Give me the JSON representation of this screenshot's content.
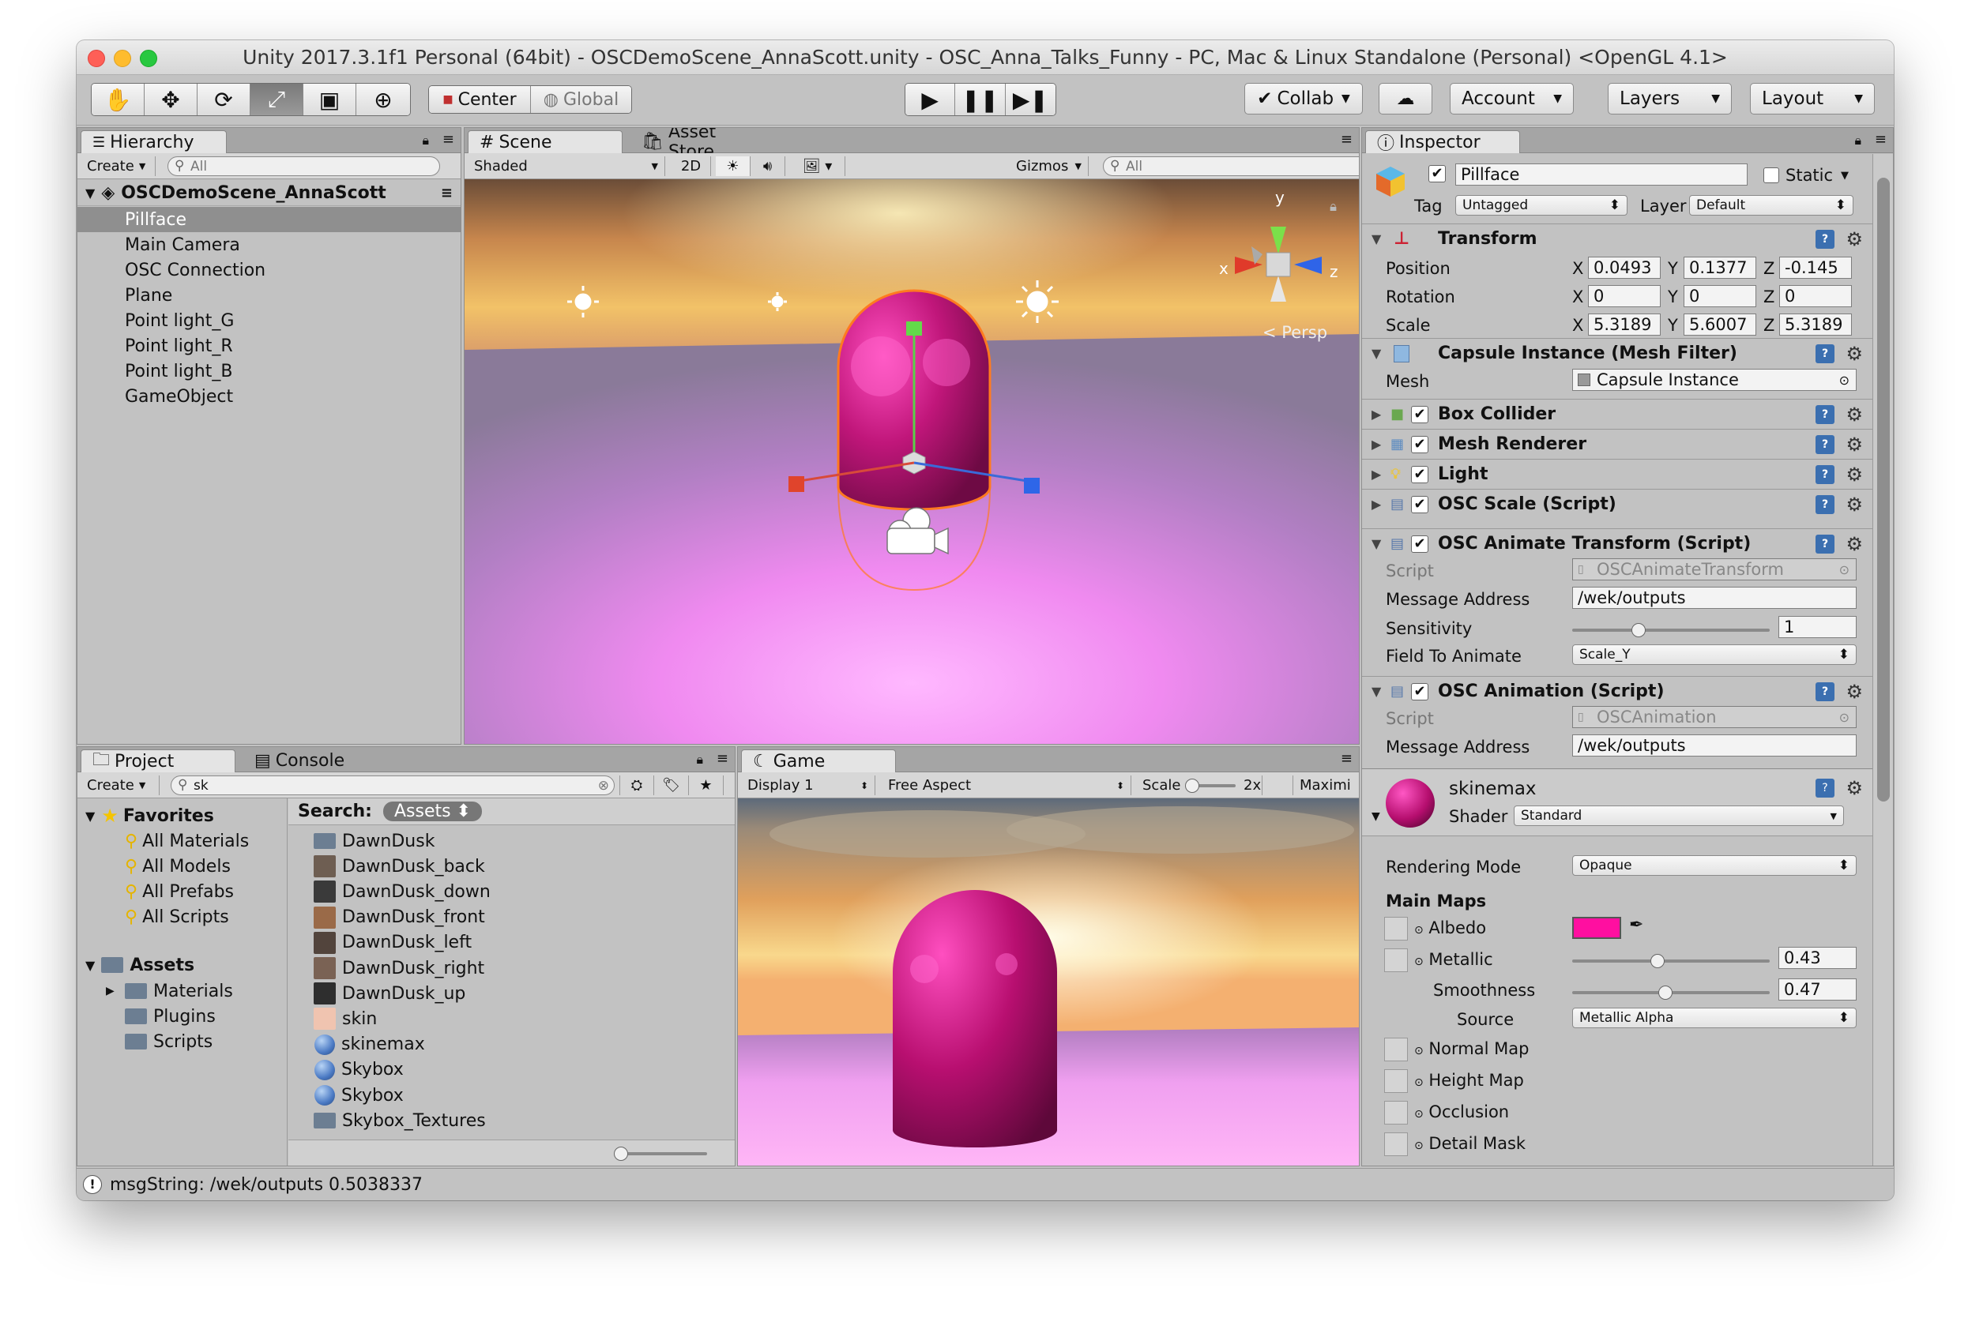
{
  "window": {
    "title": "Unity 2017.3.1f1 Personal (64bit) - OSCDemoScene_AnnaScott.unity - OSC_Anna_Talks_Funny - PC, Mac & Linux Standalone (Personal) <OpenGL 4.1>"
  },
  "toolbar": {
    "tools": [
      "hand-tool",
      "move-tool",
      "rotate-tool",
      "scale-tool",
      "rect-tool",
      "transform-tool"
    ],
    "pivot_label": "Center",
    "space_label": "Global",
    "collab_label": "Collab",
    "account_label": "Account",
    "layers_label": "Layers",
    "layout_label": "Layout"
  },
  "hierarchy": {
    "tab": "Hierarchy",
    "create": "Create",
    "search_placeholder": "All",
    "scene_name": "OSCDemoScene_AnnaScott",
    "items": [
      "Pillface",
      "Main Camera",
      "OSC Connection",
      "Plane",
      "Point light_G",
      "Point light_R",
      "Point light_B",
      "GameObject"
    ],
    "selected": "Pillface"
  },
  "scene": {
    "tab": "Scene",
    "tab2": "Asset Store",
    "shading": "Shaded",
    "mode2d": "2D",
    "gizmos": "Gizmos",
    "search_placeholder": "All",
    "persp": "Persp",
    "axis_y": "y",
    "axis_x": "x",
    "axis_z": "z"
  },
  "project": {
    "tab": "Project",
    "tab2": "Console",
    "create": "Create",
    "search_value": "sk",
    "search_label": "Search:",
    "search_scope": "Assets",
    "favorites_label": "Favorites",
    "favorites": [
      "All Materials",
      "All Models",
      "All Prefabs",
      "All Scripts"
    ],
    "assets_label": "Assets",
    "folders": [
      "Materials",
      "Plugins",
      "Scripts"
    ],
    "results": [
      {
        "name": "DawnDusk",
        "icon": "folder-icon"
      },
      {
        "name": "DawnDusk_back",
        "icon": "texture-icon"
      },
      {
        "name": "DawnDusk_down",
        "icon": "texture-icon"
      },
      {
        "name": "DawnDusk_front",
        "icon": "texture-icon"
      },
      {
        "name": "DawnDusk_left",
        "icon": "texture-icon"
      },
      {
        "name": "DawnDusk_right",
        "icon": "texture-icon"
      },
      {
        "name": "DawnDusk_up",
        "icon": "texture-icon"
      },
      {
        "name": "skin",
        "icon": "texture-icon"
      },
      {
        "name": "skinemax",
        "icon": "material-icon"
      },
      {
        "name": "Skybox",
        "icon": "material-icon"
      },
      {
        "name": "Skybox",
        "icon": "material-icon"
      },
      {
        "name": "Skybox_Textures",
        "icon": "folder-icon"
      }
    ]
  },
  "game": {
    "tab": "Game",
    "display": "Display 1",
    "aspect": "Free Aspect",
    "scale_label": "Scale",
    "scale_value": "2x",
    "maximize": "Maximi"
  },
  "inspector": {
    "tab": "Inspector",
    "object_name": "Pillface",
    "static_label": "Static",
    "tag_label": "Tag",
    "tag_value": "Untagged",
    "layer_label": "Layer",
    "layer_value": "Default",
    "transform": {
      "title": "Transform",
      "position_label": "Position",
      "rotation_label": "Rotation",
      "scale_label": "Scale",
      "x": "X",
      "y": "Y",
      "z": "Z",
      "position": [
        "0.0493",
        "0.1377",
        "-0.145"
      ],
      "rotation": [
        "0",
        "0",
        "0"
      ],
      "scale": [
        "5.3189",
        "5.6007",
        "5.3189"
      ]
    },
    "mesh_filter": {
      "title": "Capsule Instance (Mesh Filter)",
      "mesh_label": "Mesh",
      "mesh_value": "Capsule Instance"
    },
    "components": [
      "Box Collider",
      "Mesh Renderer",
      "Light",
      "OSC Scale (Script)"
    ],
    "animate_transform": {
      "title": "OSC Animate Transform (Script)",
      "script_label": "Script",
      "script_value": "OSCAnimateTransform",
      "address_label": "Message Address",
      "address_value": "/wek/outputs",
      "sensitivity_label": "Sensitivity",
      "sensitivity_value": "1",
      "field_label": "Field To Animate",
      "field_value": "Scale_Y"
    },
    "animation": {
      "title": "OSC Animation (Script)",
      "script_label": "Script",
      "script_value": "OSCAnimation",
      "address_label": "Message Address",
      "address_value": "/wek/outputs"
    },
    "material": {
      "name": "skinemax",
      "shader_label": "Shader",
      "shader_value": "Standard",
      "rendering_mode_label": "Rendering Mode",
      "rendering_mode_value": "Opaque",
      "main_maps_label": "Main Maps",
      "albedo_label": "Albedo",
      "albedo_color": "#ff0fa0",
      "metallic_label": "Metallic",
      "metallic_value": "0.43",
      "smoothness_label": "Smoothness",
      "smoothness_value": "0.47",
      "source_label": "Source",
      "source_value": "Metallic Alpha",
      "normal_map_label": "Normal Map",
      "height_map_label": "Height Map",
      "occlusion_label": "Occlusion",
      "detail_mask_label": "Detail Mask"
    }
  },
  "status": {
    "message": "msgString: /wek/outputs 0.5038337"
  },
  "colors": {
    "accent": "#3b6fb0",
    "capsule": "#b0106a"
  }
}
